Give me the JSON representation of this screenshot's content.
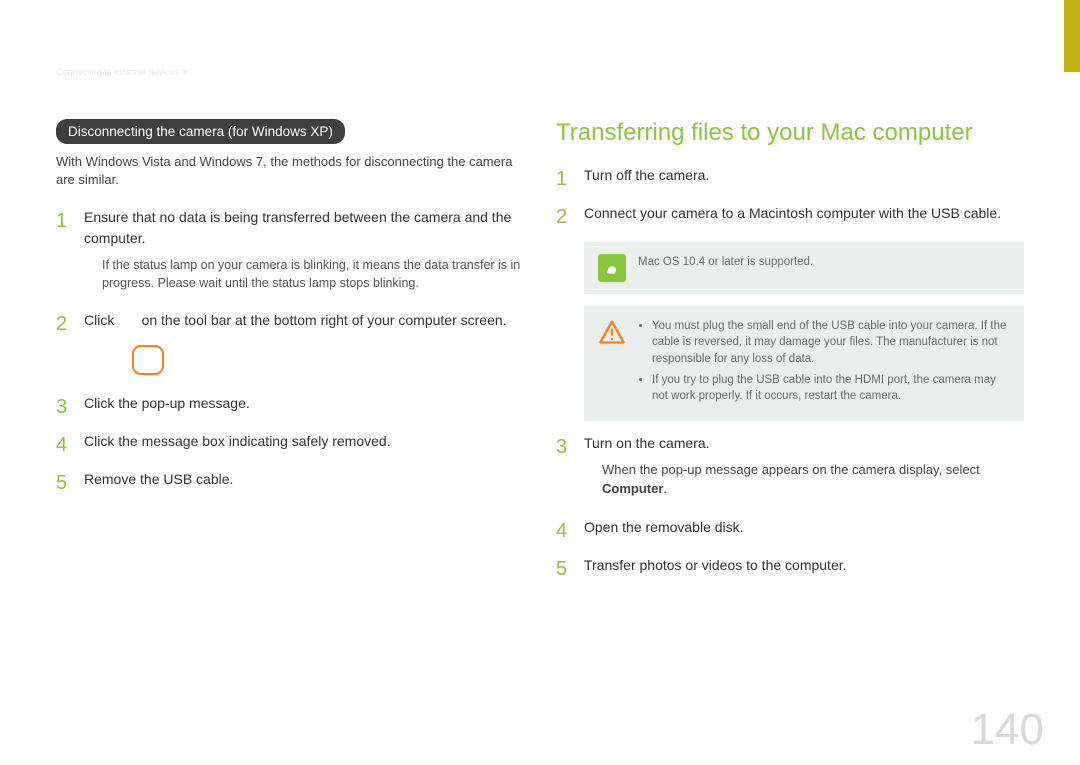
{
  "breadcrumb": "Connecting to external devices >",
  "page_number": "140",
  "left": {
    "pill_heading": "Disconnecting the camera (for Windows XP)",
    "intro": "With Windows Vista and Windows 7, the methods for disconnecting the camera are similar.",
    "steps": [
      {
        "text": "Ensure that no data is being transferred between the camera and the computer.",
        "sub": "If the status lamp on your camera is blinking, it means the data transfer is in progress. Please wait until the status lamp stops blinking."
      },
      {
        "text_prefix": "Click ",
        "text_suffix": " on the tool bar at the bottom right of your computer screen.",
        "has_icon": true
      },
      {
        "text": "Click the pop-up message."
      },
      {
        "text": "Click the message box indicating safely removed."
      },
      {
        "text": "Remove the USB cable."
      }
    ]
  },
  "right": {
    "title": "Transferring ﬁles to your Mac computer",
    "steps": [
      {
        "text": "Turn off the camera."
      },
      {
        "text": "Connect your camera to a Macintosh computer with the USB cable."
      },
      {
        "text": "Turn on the camera.",
        "tip_prefix": "When the pop-up message appears on the camera display, select ",
        "tip_bold": "Computer",
        "tip_suffix": "."
      },
      {
        "text": "Open the removable disk."
      },
      {
        "text": "Transfer photos or videos to the computer."
      }
    ],
    "note_pen": "Mac OS 10.4 or later is supported.",
    "note_warn_items": [
      "You must plug the small end of the USB cable into your camera. If the cable is reversed, it may damage your files. The manufacturer is not responsible for any loss of data.",
      "If you try to plug the USB cable into the HDMI port, the camera may not work properly. If it occurs, restart the camera."
    ]
  }
}
